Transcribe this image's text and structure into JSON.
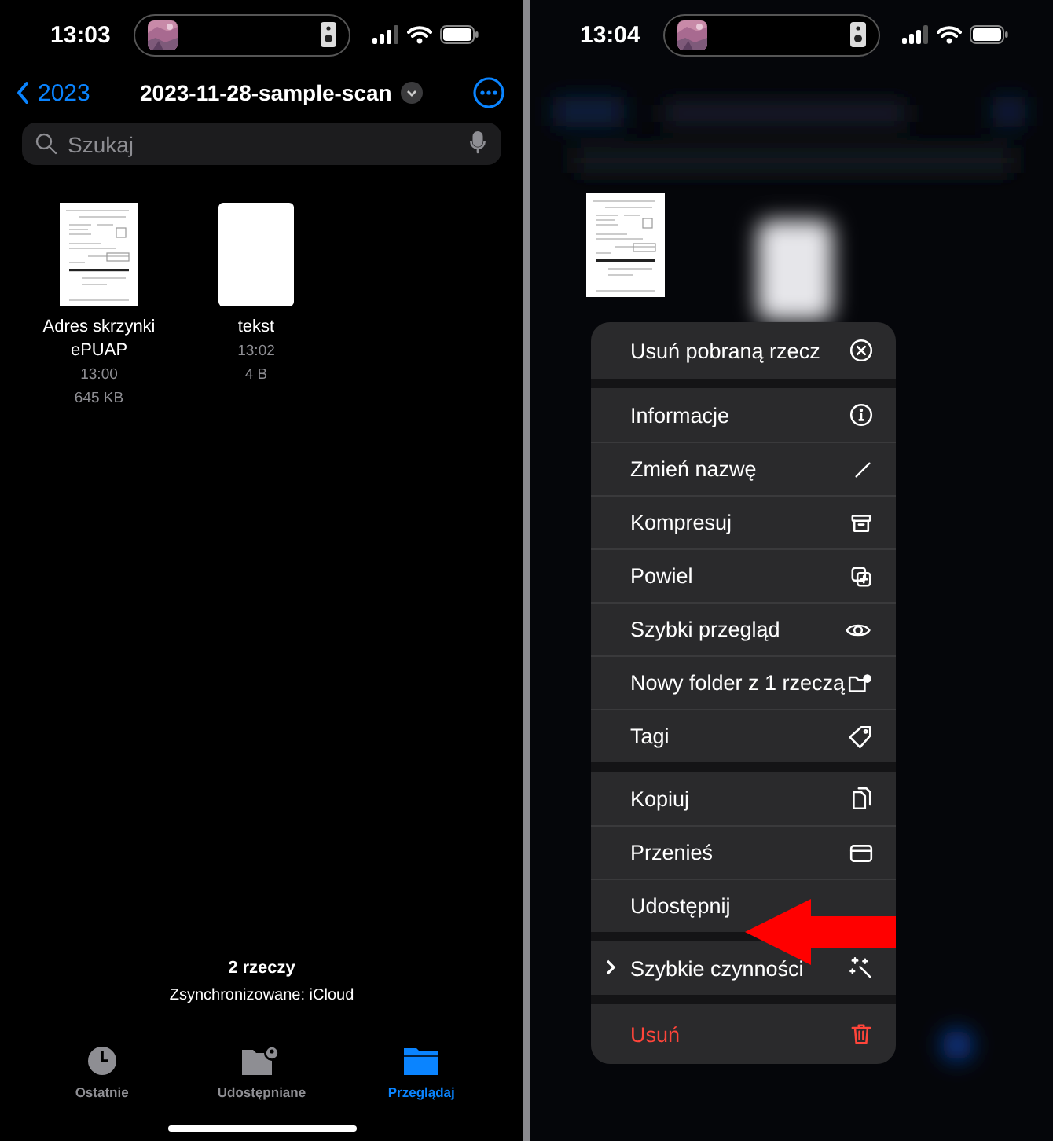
{
  "left": {
    "status_bar": {
      "time": "13:03"
    },
    "nav": {
      "back": "2023",
      "title": "2023-11-28-sample-scan"
    },
    "search": {
      "placeholder": "Szukaj"
    },
    "files": [
      {
        "name": "Adres skrzynki ePUAP",
        "time": "13:00",
        "size": "645 KB",
        "kind": "document"
      },
      {
        "name": "tekst",
        "time": "13:02",
        "size": "4 B",
        "kind": "blank"
      }
    ],
    "footer": {
      "count": "2 rzeczy",
      "sync": "Zsynchronizowane: iCloud"
    },
    "tabs": [
      {
        "label": "Ostatnie",
        "selected": false
      },
      {
        "label": "Udostępniane",
        "selected": false
      },
      {
        "label": "Przeglądaj",
        "selected": true
      }
    ]
  },
  "right": {
    "status_bar": {
      "time": "13:04"
    },
    "menu": {
      "groups": [
        [
          {
            "label": "Usuń pobraną rzecz",
            "destructive": false,
            "submenu": false
          }
        ],
        [
          {
            "label": "Informacje",
            "destructive": false,
            "submenu": false
          },
          {
            "label": "Zmień nazwę",
            "destructive": false,
            "submenu": false
          },
          {
            "label": "Kompresuj",
            "destructive": false,
            "submenu": false
          },
          {
            "label": "Powiel",
            "destructive": false,
            "submenu": false
          },
          {
            "label": "Szybki przegląd",
            "destructive": false,
            "submenu": false
          },
          {
            "label": "Nowy folder z 1 rzeczą",
            "destructive": false,
            "submenu": false
          },
          {
            "label": "Tagi",
            "destructive": false,
            "submenu": false
          }
        ],
        [
          {
            "label": "Kopiuj",
            "destructive": false,
            "submenu": false
          },
          {
            "label": "Przenieś",
            "destructive": false,
            "submenu": false
          },
          {
            "label": "Udostępnij",
            "destructive": false,
            "submenu": false
          }
        ],
        [
          {
            "label": "Szybkie czynności",
            "destructive": false,
            "submenu": true
          }
        ],
        [
          {
            "label": "Usuń",
            "destructive": true,
            "submenu": false
          }
        ]
      ]
    }
  }
}
